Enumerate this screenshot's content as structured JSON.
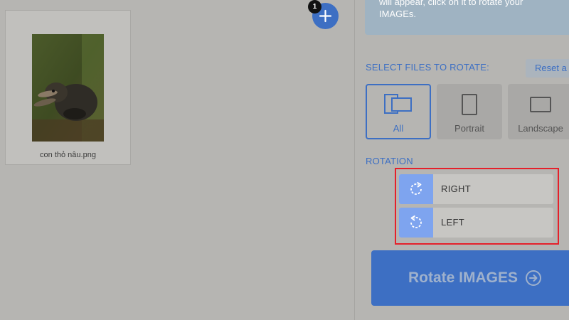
{
  "workspace": {
    "file": {
      "name": "con thỏ nâu.png"
    },
    "add_button": {
      "count": "1",
      "icon": "plus-icon"
    }
  },
  "panel": {
    "info_lines": [
      "will appear, click on it to rotate your",
      "IMAGEs."
    ],
    "select_label": "SELECT FILES TO ROTATE:",
    "reset_label": "Reset a",
    "filters": [
      {
        "label": "All",
        "icon": "all-orientation-icon",
        "selected": true
      },
      {
        "label": "Portrait",
        "icon": "portrait-icon",
        "selected": false
      },
      {
        "label": "Landscape",
        "icon": "landscape-icon",
        "selected": false
      }
    ],
    "rotation_label": "ROTATION",
    "rotation_buttons": [
      {
        "label": "RIGHT",
        "icon": "rotate-right-icon"
      },
      {
        "label": "LEFT",
        "icon": "rotate-left-icon"
      }
    ],
    "rotate_button": {
      "label": "Rotate IMAGES",
      "icon": "arrow-circle-right-icon"
    }
  },
  "colors": {
    "accent": "#3d6fc3",
    "highlight_border": "#e5202a",
    "icon_cell": "#7ea4ef",
    "overlay_gray": "#b6b5b2"
  }
}
